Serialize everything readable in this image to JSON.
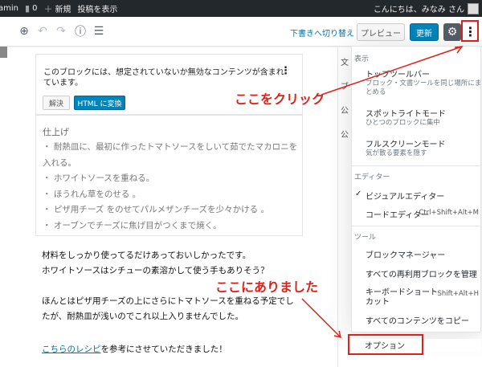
{
  "admin_bar": {
    "site_name": "amin",
    "comments_count": "0",
    "new_label": "新規",
    "view_post_label": "投稿を表示",
    "greeting": "こんにちは、みなみ さん"
  },
  "toolbar": {
    "switch_to_draft": "下書きへ切り替え",
    "preview_label": "プレビュー",
    "update_label": "更新"
  },
  "invalid_block": {
    "message": "このブロックには、想定されていないか無効なコンテンツが含まれています。",
    "resolve_label": "解決",
    "convert_html_label": "HTML に変換",
    "preview_title": "仕上げ",
    "preview_lines": [
      "・ 耐熱皿に、最初に作ったトマトソースをしいて茹でたマカロニを",
      "入れる。",
      "・ ホワイトソースを重ねる。",
      "・ ほうれん草をのせる 。",
      "・ ピザ用チーズ をのせてパルメザンチーズを少々かける 。",
      "・ オーブンでチーズに焦げ目がつくまで焼く。"
    ]
  },
  "content": {
    "para1_line1": "材料をしっかり使ってるだけあっておいしかったです。",
    "para1_line2": "ホワイトソースはシチューの素溶かして使う手もありそう？",
    "para2_line1": "ほんとはピザ用チーズの上にさらにトマトソースを重ねる予定でし",
    "para2_line2": "たが、耐熱皿が浅いのでこれ以上入りませんでした。",
    "link_text": "こちらのレシピ",
    "para3_rest": "を参考にさせていただきました！"
  },
  "sidebar_fragments": {
    "frag1": "文",
    "frag2": "ブ",
    "frag3": "公",
    "frag4": "公"
  },
  "menu": {
    "view_group": "表示",
    "editor_group": "エディター",
    "tools_group": "ツール",
    "view_items": [
      {
        "label": "トップツールバー",
        "sub1": "ブロック・文書ツールを同じ場所にま",
        "sub2": "とめる"
      },
      {
        "label": "スポットライトモード",
        "sub1": "ひとつのブロックに集中",
        "sub2": ""
      },
      {
        "label": "フルスクリーンモード",
        "sub1": "気が散る要素を隠す",
        "sub2": ""
      }
    ],
    "editor_items": [
      {
        "label": "ビジュアルエディター",
        "checked": "✓",
        "shortcut": ""
      },
      {
        "label": "コードエディター",
        "checked": "",
        "shortcut": "Ctrl+Shift+Alt+M"
      }
    ],
    "tools_items": [
      {
        "label": "ブロックマネージャー",
        "label2": "",
        "shortcut": ""
      },
      {
        "label": "すべての再利用ブロックを管理",
        "label2": "",
        "shortcut": ""
      },
      {
        "label": "キーボードショート",
        "label2": "カット",
        "shortcut": "Shift+Alt+H"
      },
      {
        "label": "すべてのコンテンツをコピー",
        "label2": "",
        "shortcut": ""
      }
    ],
    "options_label": "オプション"
  },
  "annotations": {
    "click_here": "ここをクリック",
    "found_here": "ここにありました"
  },
  "colors": {
    "annotation_red": "#e0211a",
    "primary_blue": "#0085ba",
    "admin_bar": "#23282d"
  }
}
